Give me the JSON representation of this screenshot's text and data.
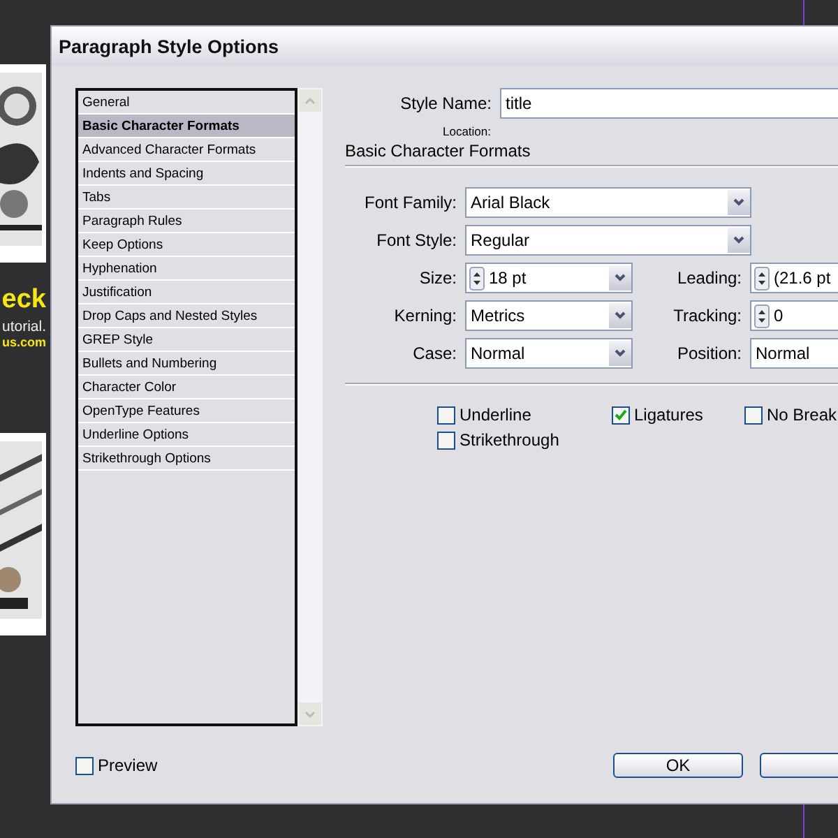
{
  "document": {
    "headline": "eck",
    "subtitle": "utorial.",
    "url": "us.com"
  },
  "window": {
    "title": "Paragraph Style Options"
  },
  "categories": [
    {
      "label": "General",
      "selected": false
    },
    {
      "label": "Basic Character Formats",
      "selected": true
    },
    {
      "label": "Advanced Character Formats",
      "selected": false
    },
    {
      "label": "Indents and Spacing",
      "selected": false
    },
    {
      "label": "Tabs",
      "selected": false
    },
    {
      "label": "Paragraph Rules",
      "selected": false
    },
    {
      "label": "Keep Options",
      "selected": false
    },
    {
      "label": "Hyphenation",
      "selected": false
    },
    {
      "label": "Justification",
      "selected": false
    },
    {
      "label": "Drop Caps and Nested Styles",
      "selected": false
    },
    {
      "label": "GREP Style",
      "selected": false
    },
    {
      "label": "Bullets and Numbering",
      "selected": false
    },
    {
      "label": "Character Color",
      "selected": false
    },
    {
      "label": "OpenType Features",
      "selected": false
    },
    {
      "label": "Underline Options",
      "selected": false
    },
    {
      "label": "Strikethrough Options",
      "selected": false
    }
  ],
  "style_name": {
    "label": "Style Name:",
    "value": "title"
  },
  "location": {
    "label": "Location:",
    "value": "Basic Character Formats"
  },
  "wide_fields": [
    {
      "label": "Font Family:",
      "value": "Arial Black",
      "kind": "dropdown"
    },
    {
      "label": "Font Style:",
      "value": "Regular",
      "kind": "dropdown"
    }
  ],
  "field_rows": [
    [
      {
        "label": "Size:",
        "value": "18 pt",
        "kind": "spin-dropdown"
      },
      {
        "label": "Leading:",
        "value": "(21.6 pt",
        "kind": "spin"
      }
    ],
    [
      {
        "label": "Kerning:",
        "value": "Metrics",
        "kind": "dropdown"
      },
      {
        "label": "Tracking:",
        "value": "0",
        "kind": "spin"
      }
    ],
    [
      {
        "label": "Case:",
        "value": "Normal",
        "kind": "dropdown"
      },
      {
        "label": "Position:",
        "value": "Normal",
        "kind": "plain"
      }
    ]
  ],
  "options": [
    {
      "label": "Underline",
      "checked": false
    },
    {
      "label": "Ligatures",
      "checked": true
    },
    {
      "label": "No Break",
      "checked": false
    },
    {
      "label": "Strikethrough",
      "checked": false
    }
  ],
  "preview": {
    "label": "Preview",
    "checked": false
  },
  "buttons": [
    "OK"
  ]
}
